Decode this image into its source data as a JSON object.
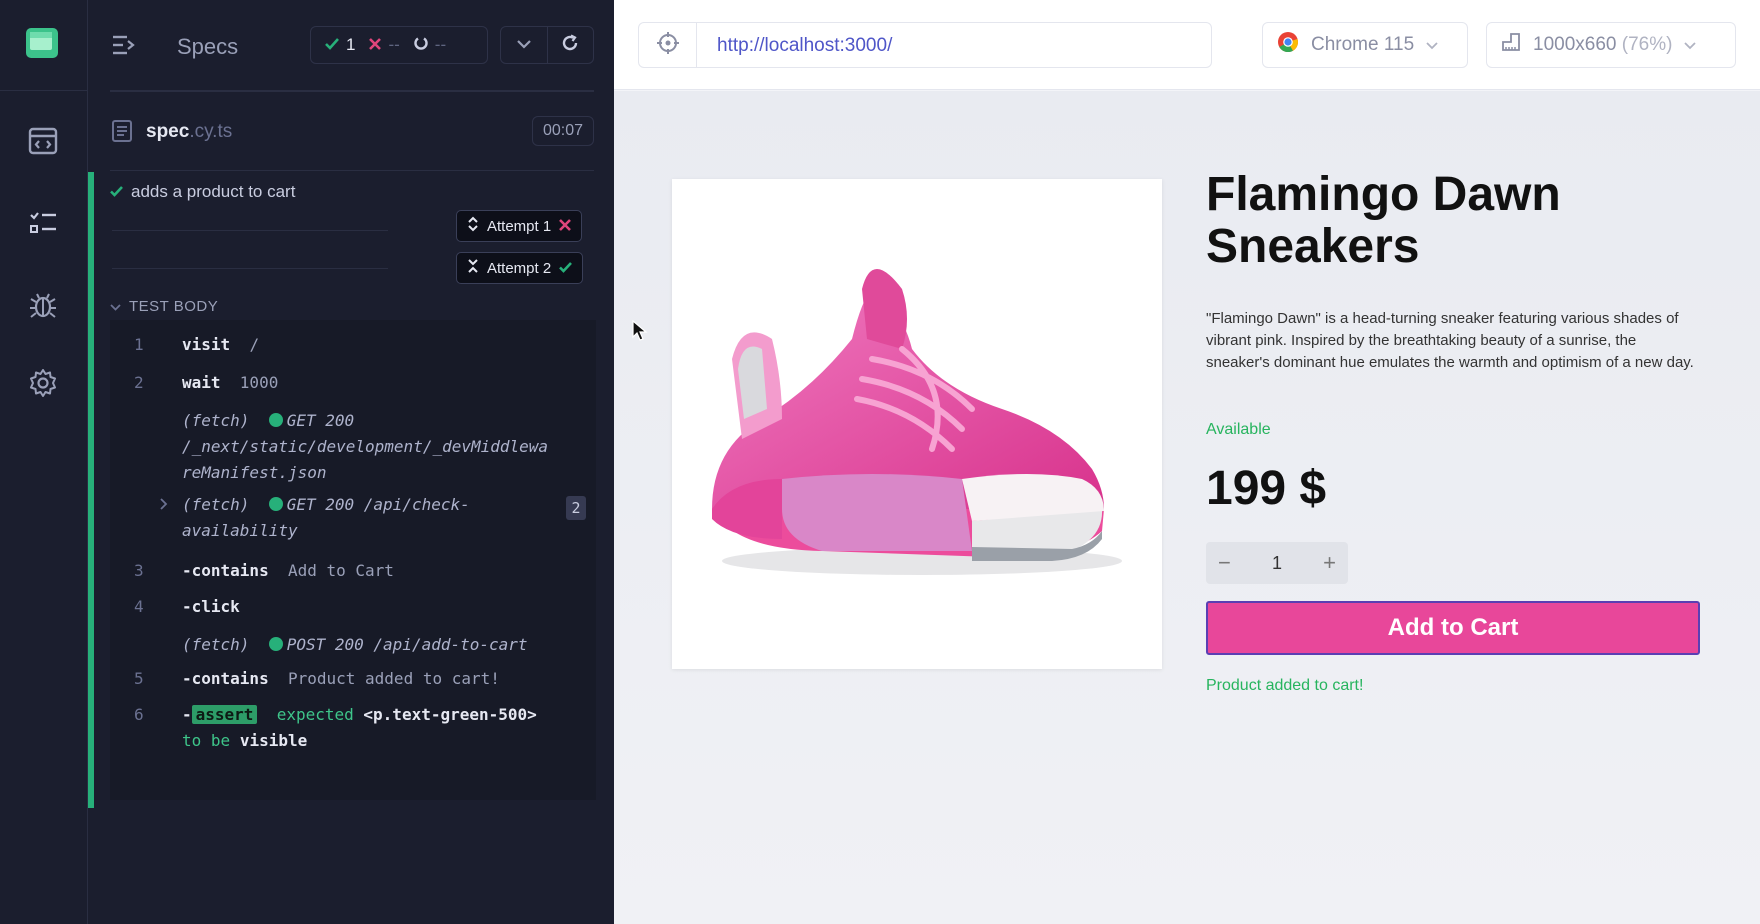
{
  "reporter": {
    "specs_label": "Specs",
    "stats": {
      "passed": "1",
      "failed": "--",
      "pending": "--"
    },
    "spec_file": {
      "name": "spec",
      "ext": ".cy.ts",
      "time": "00:07"
    },
    "test_title": "adds a product to cart",
    "attempts": [
      {
        "label": "Attempt 1",
        "status": "failed"
      },
      {
        "label": "Attempt 2",
        "status": "passed"
      }
    ],
    "test_body_label": "TEST BODY",
    "commands": {
      "c1": {
        "num": "1",
        "name": "visit",
        "arg": "/"
      },
      "c2": {
        "num": "2",
        "name": "wait",
        "arg": "1000"
      },
      "f1": {
        "type": "(fetch)",
        "status": "GET 200",
        "path": "/_next/static/development/_devMiddlewa",
        "path2": "reManifest.json"
      },
      "f2": {
        "type": "(fetch)",
        "status": "GET 200",
        "path": "/api/check-",
        "path2": "availability",
        "count": "2"
      },
      "c3": {
        "num": "3",
        "name": "-contains",
        "arg": "Add to Cart"
      },
      "c4": {
        "num": "4",
        "name": "-click"
      },
      "f3": {
        "type": "(fetch)",
        "status": "POST 200",
        "path": "/api/add-to-cart"
      },
      "c5": {
        "num": "5",
        "name": "-contains",
        "arg": "Product added to cart!"
      },
      "c6": {
        "num": "6",
        "dash": "-",
        "badge": "assert",
        "expected": "expected",
        "selector": "<p.text-green-500>",
        "to": "to be",
        "visible": "visible"
      }
    }
  },
  "browser_bar": {
    "url": "http://localhost:3000/",
    "browser": "Chrome 115",
    "viewport": "1000x660",
    "zoom": "(76%)"
  },
  "product": {
    "title": "Flamingo Dawn Sneakers",
    "description": "\"Flamingo Dawn\" is a head-turning sneaker featuring various shades of vibrant pink. Inspired by the breathtaking beauty of a sunrise, the sneaker's dominant hue emulates the warmth and optimism of a new day.",
    "availability": "Available",
    "price": "199 $",
    "quantity": "1",
    "add_button": "Add to Cart",
    "added_message": "Product added to cart!"
  },
  "colors": {
    "pass_green": "#27b07a",
    "fail_red": "#e0457b",
    "accent_pink": "#e8479a",
    "link_blue": "#4f56c8"
  }
}
